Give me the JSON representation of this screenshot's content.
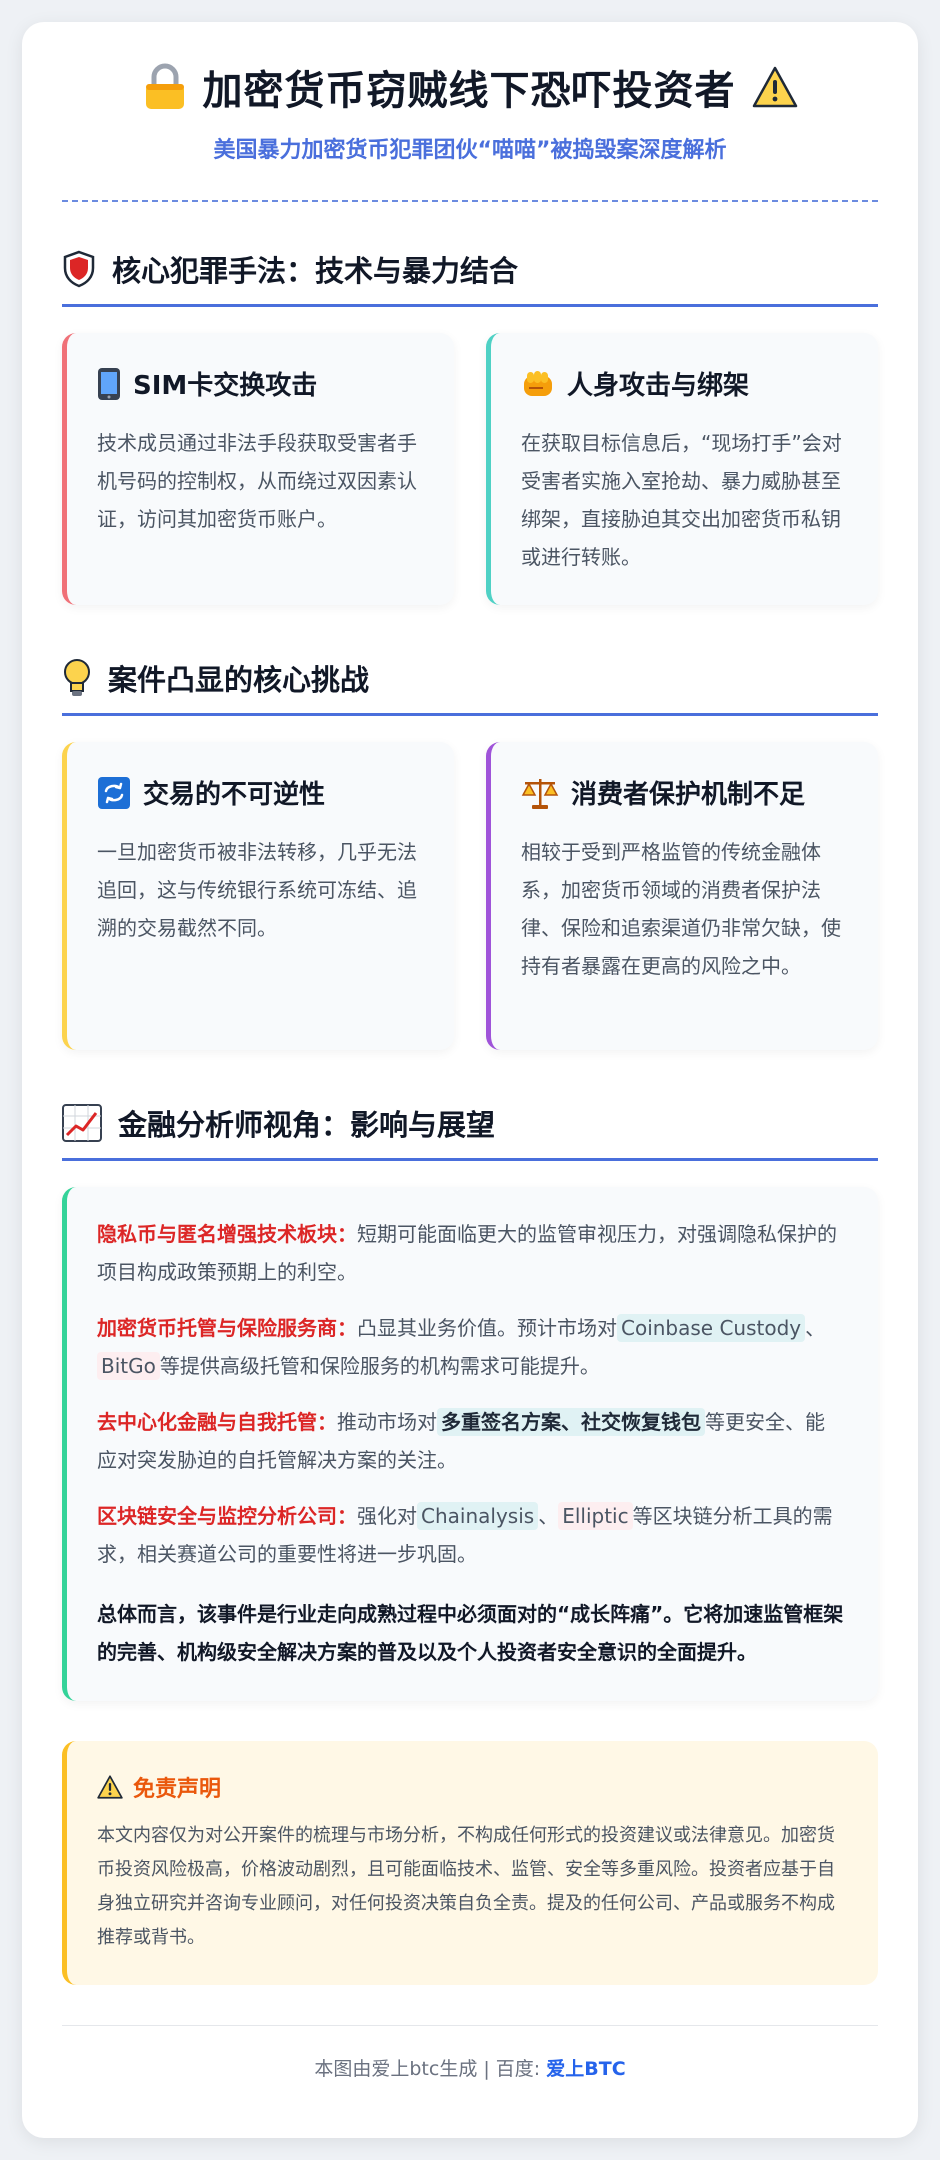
{
  "header": {
    "title": "加密货币窃贼线下恐吓投资者",
    "subtitle": "美国暴力加密货币犯罪团伙“喵喵”被捣毁案深度解析",
    "lock_icon": "lock-icon",
    "warning_icon": "warning-icon"
  },
  "section1": {
    "title": "核心犯罪手法：技术与暴力结合",
    "icon": "shield-icon",
    "cards": [
      {
        "title": "SIM卡交换攻击",
        "icon": "mobile-phone-icon",
        "text": "技术成员通过非法手段获取受害者手机号码的控制权，从而绕过双因素认证，访问其加密货币账户。",
        "accent": "#f07178"
      },
      {
        "title": "人身攻击与绑架",
        "icon": "fist-icon",
        "text": "在获取目标信息后，“现场打手”会对受害者实施入室抢劫、暴力威胁甚至绑架，直接胁迫其交出加密货币私钥或进行转账。",
        "accent": "#4fd1c5"
      }
    ]
  },
  "section2": {
    "title": "案件凸显的核心挑战",
    "icon": "lightbulb-icon",
    "cards": [
      {
        "title": "交易的不可逆性",
        "icon": "repeat-arrows-icon",
        "text": "一旦加密货币被非法转移，几乎无法追回，这与传统银行系统可冻结、追溯的交易截然不同。",
        "accent": "#fcd34d"
      },
      {
        "title": "消费者保护机制不足",
        "icon": "balance-scale-icon",
        "text": "相较于受到严格监管的传统金融体系，加密货币领域的消费者保护法律、保险和追索渠道仍非常欠缺，使持有者暴露在更高的风险之中。",
        "accent": "#9f53d9"
      }
    ]
  },
  "section3": {
    "title": "金融分析师视角：影响与展望",
    "icon": "chart-increasing-icon",
    "points": [
      {
        "label": "隐私币与匿名增强技术板块：",
        "text": "短期可能面临更大的监管审视压力，对强调隐私保护的项目构成政策预期上的利空。"
      },
      {
        "label": "加密货币托管与保险服务商：",
        "pre": "凸显其业务价值。预计市场对",
        "tag1": "Coinbase Custody",
        "sep": "、",
        "tag2": "BitGo",
        "post": "等提供高级托管和保险服务的机构需求可能提升。"
      },
      {
        "label": "去中心化金融与自我托管：",
        "pre": "推动市场对",
        "tag1": "多重签名方案、社交恢复钱包",
        "post": "等更安全、能应对突发胁迫的自托管解决方案的关注。"
      },
      {
        "label": "区块链安全与监控分析公司：",
        "pre": "强化对",
        "tag1": "Chainalysis",
        "sep": "、",
        "tag2": "Elliptic",
        "post": "等区块链分析工具的需求，相关赛道公司的重要性将进一步巩固。"
      }
    ],
    "summary": "总体而言，该事件是行业走向成熟过程中必须面对的“成长阵痛”。它将加速监管框架的完善、机构级安全解决方案的普及以及个人投资者安全意识的全面提升。"
  },
  "disclaimer": {
    "title": "免责声明",
    "icon": "warning-icon",
    "text": "本文内容仅为对公开案件的梳理与市场分析，不构成任何形式的投资建议或法律意见。加密货币投资风险极高，价格波动剧烈，且可能面临技术、监管、安全等多重风险。投资者应基于自身独立研究并咨询专业顾问，对任何投资决策自负全责。提及的任何公司、产品或服务不构成推荐或背书。"
  },
  "footer": {
    "prefix": "本图由爱上btc生成 | 百度: ",
    "brand": "爱上BTC"
  }
}
